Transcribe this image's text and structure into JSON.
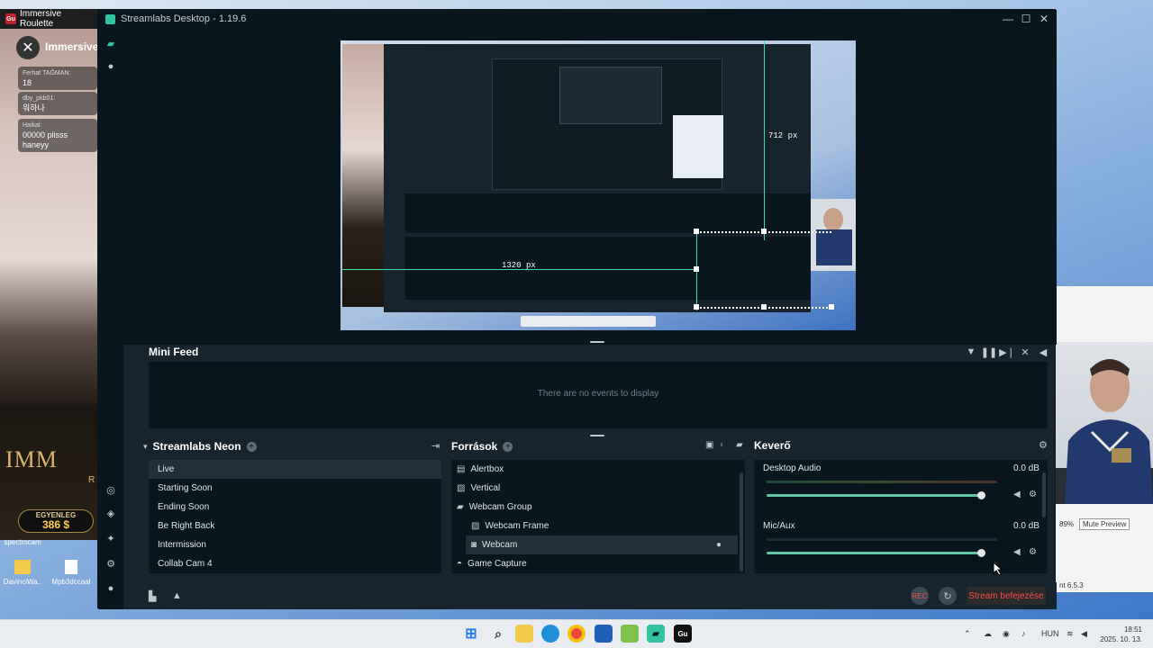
{
  "roulette": {
    "title": "Immersive Roulette",
    "header_name": "Immersive",
    "chat": [
      {
        "user": "Ferhat TAĞMAN:",
        "msg": "18"
      },
      {
        "user": "dby_pkb01:",
        "msg": "워하나"
      },
      {
        "user": "Haikal:",
        "msg": "00000 plisss haneyy"
      }
    ],
    "brand": "IMM",
    "brand_sub": "R",
    "balance_label": "EGYENLEG",
    "balance_value": "386 $"
  },
  "desktop_icons": [
    {
      "label": "spectrocam"
    },
    {
      "label": "DavinciWa.."
    },
    {
      "label": "Mpb3dccaal"
    }
  ],
  "streamlabs": {
    "title": "Streamlabs Desktop - 1.19.6",
    "preview": {
      "height_label": "712 px",
      "width_label": "1320 px"
    },
    "mini_feed": {
      "title": "Mini Feed",
      "empty_text": "There are no events to display"
    },
    "scenes": {
      "title": "Streamlabs Neon",
      "items": [
        "Live",
        "Starting Soon",
        "Ending Soon",
        "Be Right Back",
        "Intermission",
        "Collab Cam 4"
      ],
      "selected": "Live"
    },
    "sources": {
      "title": "Források",
      "items": [
        {
          "name": "Alertbox",
          "icon": "alertbox-icon"
        },
        {
          "name": "Vertical",
          "icon": "image-icon"
        },
        {
          "name": "Webcam Group",
          "icon": "folder-icon"
        },
        {
          "name": "Webcam Frame",
          "icon": "image-icon"
        },
        {
          "name": "Webcam",
          "icon": "webcam-icon"
        },
        {
          "name": "Game Capture",
          "icon": "gamepad-icon"
        }
      ],
      "selected": "Webcam"
    },
    "mixer": {
      "title": "Keverő",
      "channels": [
        {
          "name": "Desktop Audio",
          "level": "0.0 dB",
          "volume": 0.95
        },
        {
          "name": "Mic/Aux",
          "level": "0.0 dB",
          "volume": 0.95
        }
      ]
    },
    "footer": {
      "rec_label": "REC",
      "stop_label": "Stream befejezése"
    }
  },
  "right_app": {
    "zoom": "89%",
    "mute_label": "Mute Preview",
    "version": "nt 6.5.3"
  },
  "taskbar": {
    "lang": "HUN",
    "time": "18:51",
    "date": "2025. 10. 13."
  },
  "colors": {
    "accent": "#31c3a2",
    "stop": "#ff4a4a",
    "panel_bg": "#09161d",
    "window_bg": "#17242d"
  }
}
